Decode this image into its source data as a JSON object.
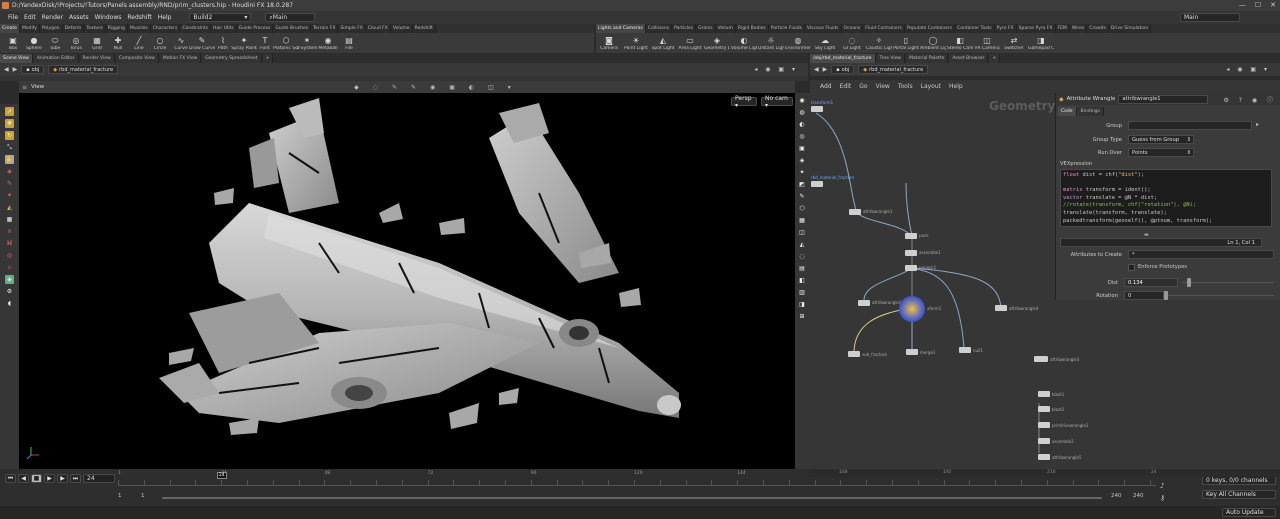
{
  "window": {
    "title": "D:/YandexDisk/!Projects/!Tutors/Panels assembly/RND/prim_clusters.hip - Houdini FX 18.0.287",
    "controls": [
      "—",
      "☐",
      "✕"
    ]
  },
  "menu": [
    "File",
    "Edit",
    "Render",
    "Assets",
    "Windows",
    "Redshift",
    "Help"
  ],
  "desktops": {
    "build": "Build2",
    "main": "Main"
  },
  "right_desktop": "Main",
  "shelf_tabs_left": [
    "Create",
    "Modify",
    "Polygon",
    "Deform",
    "Texture",
    "Rigging",
    "Muscles",
    "Characters",
    "Constraints",
    "Hair Utils",
    "Guide Process",
    "Guide Brushes",
    "Terrain FX",
    "Simple FX",
    "Cloud FX",
    "Volume",
    "Redshift"
  ],
  "shelf_tabs_right": [
    "Lights and Cameras",
    "Collisions",
    "Particles",
    "Grains",
    "Vellum",
    "Rigid Bodies",
    "Particle Fluids",
    "Viscous Fluids",
    "Oceans",
    "Fluid Containers",
    "Populate Containers",
    "Container Tools",
    "Pyro FX",
    "Sparse Pyro FX",
    "FEM",
    "Wires",
    "Crowds",
    "Drive Simulation"
  ],
  "tools_left": [
    {
      "icon": "▣",
      "label": "Box"
    },
    {
      "icon": "●",
      "label": "Sphere"
    },
    {
      "icon": "⬭",
      "label": "Tube"
    },
    {
      "icon": "◎",
      "label": "Torus"
    },
    {
      "icon": "▦",
      "label": "Grid"
    },
    {
      "icon": "✚",
      "label": "Null"
    },
    {
      "icon": "╱",
      "label": "Line"
    },
    {
      "icon": "○",
      "label": "Circle"
    },
    {
      "icon": "∿",
      "label": "Curve"
    },
    {
      "icon": "✎",
      "label": "Draw Curve"
    },
    {
      "icon": "⌇",
      "label": "Path"
    },
    {
      "icon": "✦",
      "label": "Spray Paint"
    },
    {
      "icon": "T",
      "label": "Font"
    },
    {
      "icon": "⬡",
      "label": "Platonic Solids"
    },
    {
      "icon": "✶",
      "label": "L-System"
    },
    {
      "icon": "◉",
      "label": "Metaball"
    },
    {
      "icon": "▤",
      "label": "File"
    }
  ],
  "tools_right": [
    {
      "icon": "◙",
      "label": "Camera"
    },
    {
      "icon": "☀",
      "label": "Point Light"
    },
    {
      "icon": "◭",
      "label": "Spot Light"
    },
    {
      "icon": "▭",
      "label": "Area Light"
    },
    {
      "icon": "◈",
      "label": "Geometry Light"
    },
    {
      "icon": "◐",
      "label": "Volume Light"
    },
    {
      "icon": "☼",
      "label": "Distant Light"
    },
    {
      "icon": "◍",
      "label": "Environment Light"
    },
    {
      "icon": "☁",
      "label": "Sky Light"
    },
    {
      "icon": "◌",
      "label": "GI Light"
    },
    {
      "icon": "✧",
      "label": "Caustic Light"
    },
    {
      "icon": "▯",
      "label": "Portal Light"
    },
    {
      "icon": "◯",
      "label": "Ambient Light"
    },
    {
      "icon": "◧",
      "label": "Stereo Camera"
    },
    {
      "icon": "◫",
      "label": "VR Camera"
    },
    {
      "icon": "⇄",
      "label": "Switcher"
    },
    {
      "icon": "◨",
      "label": "Gamepad Camera"
    }
  ],
  "left_pane_tabs": [
    "Scene View",
    "Animation Editor",
    "Render View",
    "Composite View",
    "Motion FX View",
    "Geometry Spreadsheet"
  ],
  "left_path": {
    "obj": "obj",
    "node": "rbd_material_fracture"
  },
  "viewport": {
    "title": "View",
    "persp": "Persp ▾",
    "cam": "No cam ▾"
  },
  "right_pane_tabs": [
    "/obj/rbd_material_fracture",
    "Tree View",
    "Material Palette",
    "Asset Browser"
  ],
  "right_path": {
    "obj": "obj",
    "node": "rbd_material_fracture"
  },
  "net_menu": [
    "Add",
    "Edit",
    "Go",
    "View",
    "Tools",
    "Layout",
    "Help"
  ],
  "net_title": "Geometry",
  "nodes": [
    {
      "label": "transform1"
    },
    {
      "label": "rbd_material_fracture"
    },
    {
      "label": "attribwrangle1"
    },
    {
      "label": "pack"
    },
    {
      "label": "assemble1"
    },
    {
      "label": "unpack1"
    },
    {
      "label": "attribwrangle2"
    },
    {
      "label": "xform1"
    },
    {
      "label": "merge1"
    },
    {
      "label": "sub_fracture"
    },
    {
      "label": "null1"
    },
    {
      "label": "attribwrangle4"
    },
    {
      "label": "attribwrangle3"
    },
    {
      "label": "blast1"
    },
    {
      "label": "blast2"
    },
    {
      "label": "primitivewrangle2"
    },
    {
      "label": "assemble2"
    },
    {
      "label": "attribwrangle5"
    }
  ],
  "parm": {
    "type": "Attribute Wrangle",
    "name": "attribwrangle1",
    "tabs": [
      "Code",
      "Bindings"
    ],
    "group_label": "Group",
    "group_value": "",
    "group_type_label": "Group Type",
    "group_type": "Guess from Group",
    "run_over_label": "Run Over",
    "run_over": "Points",
    "vex_label": "VEXpression",
    "status": "Ln 1, Col 1",
    "attr_create_label": "Attributes to Create",
    "attr_create": "*",
    "enforce_label": "Enforce Prototypes",
    "dist_label": "Dist",
    "dist": "0.134",
    "dist_frac": 0.06,
    "rot_label": "Rotation",
    "rotation": "0",
    "rot_frac": 0.0
  },
  "code": [
    [
      [
        "kw",
        "float"
      ],
      [
        "fn",
        " dist = chf("
      ],
      [
        "st",
        "\"dist\""
      ],
      [
        "fn",
        ");"
      ]
    ],
    [],
    [
      [
        "kw",
        "matrix"
      ],
      [
        "fn",
        " transform = ident();"
      ]
    ],
    [
      [
        "kw",
        "vector"
      ],
      [
        "fn",
        " translate = @N * dist;"
      ]
    ],
    [
      [
        "cm",
        "//rotate(transform, chf(\"rotation\"), @N);"
      ]
    ],
    [
      [
        "fn",
        "translate(transform, translate);"
      ]
    ],
    [
      [
        "fn",
        "packedtransform(geoself(), @ptnum, transform);"
      ]
    ]
  ],
  "timeline": {
    "current": "24",
    "start": "1",
    "start2": "1",
    "end": "240",
    "end2": "240",
    "ticks": [
      "1",
      "24",
      "48",
      "72",
      "96",
      "120",
      "144",
      "168",
      "192",
      "216",
      "240"
    ],
    "current_frac": 0.1,
    "keys": "0 keys, 0/0 channels",
    "keys_mode": "Key All Channels",
    "auto": "Auto Update"
  },
  "net_ticks": [
    "168",
    "192",
    "216",
    "24"
  ]
}
